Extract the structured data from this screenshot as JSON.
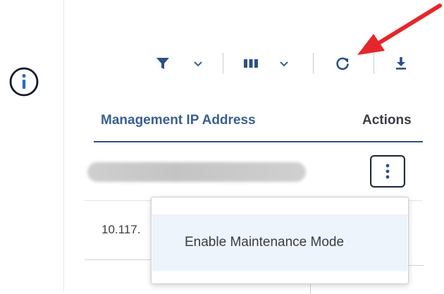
{
  "colors": {
    "brand": "#2d4f85",
    "header_text": "#3b5f93",
    "annotation_arrow": "#e5262b",
    "menu_hover": "#eef4fc"
  },
  "toolbar": {
    "filter_icon": "filter-icon",
    "columns_icon": "columns-icon",
    "refresh_icon": "refresh-icon",
    "download_icon": "download-icon"
  },
  "table": {
    "headers": [
      "Management IP Address",
      "Actions"
    ],
    "rows": [
      {
        "ip": ""
      },
      {
        "ip": "10.117."
      }
    ]
  },
  "actions_menu": {
    "items": [
      "Enable Maintenance Mode"
    ]
  }
}
